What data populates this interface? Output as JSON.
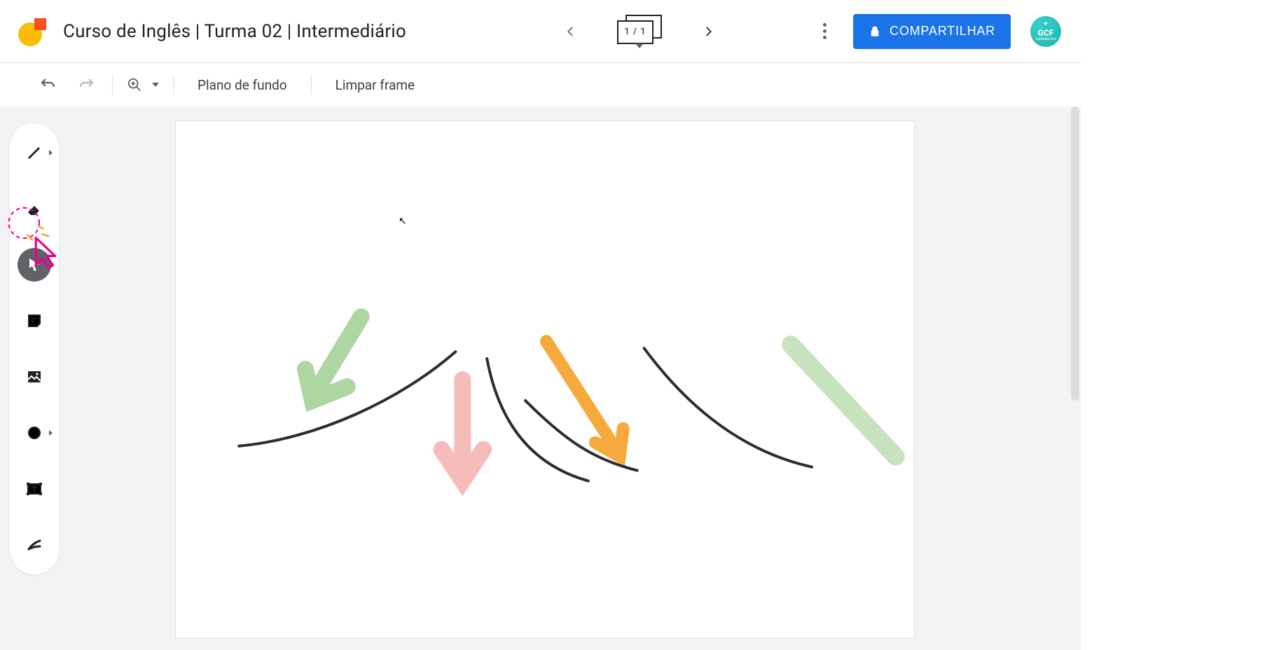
{
  "header": {
    "title": "Curso de Inglês | Turma 02 | Intermediário",
    "frame_label": "1 / 1",
    "share_label": "COMPARTILHAR",
    "avatar_text": "GCF",
    "avatar_sub": "AprendeLivre"
  },
  "subbar": {
    "background_label": "Plano de fundo",
    "clear_label": "Limpar frame"
  },
  "tools": {
    "pen": "pen-tool",
    "eraser": "eraser-tool",
    "select": "select-tool",
    "note": "sticky-note-tool",
    "image": "image-tool",
    "shape": "shape-tool",
    "textbox": "textbox-tool",
    "laser": "laser-tool"
  }
}
